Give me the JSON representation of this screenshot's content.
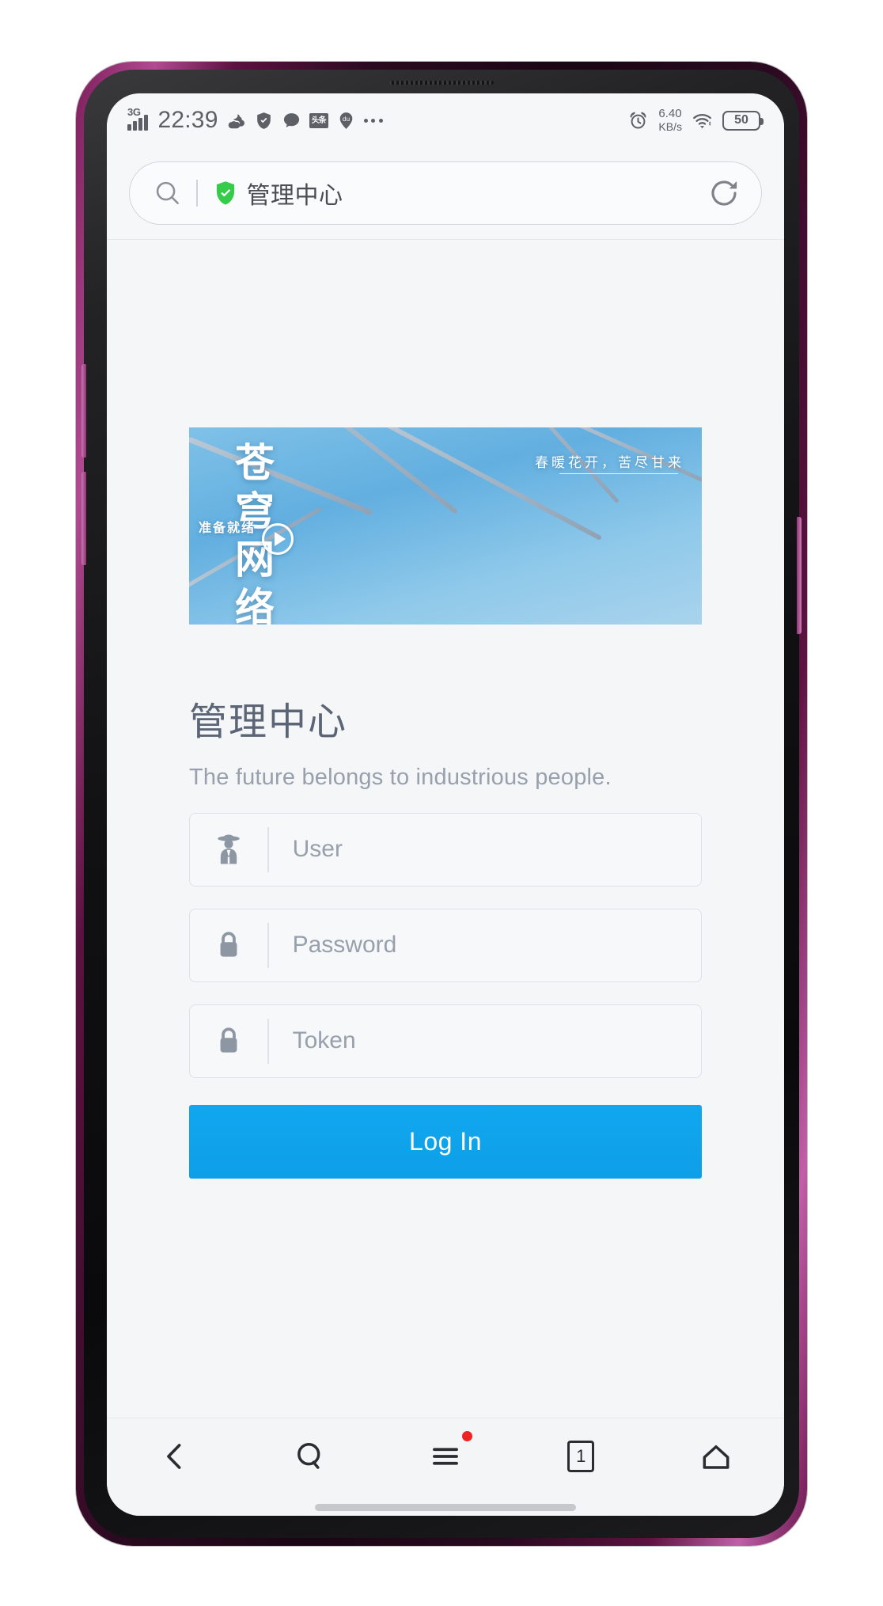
{
  "status_bar": {
    "network_type": "3G",
    "clock": "22:39",
    "icons": [
      "weather-cloud-icon",
      "shield-icon",
      "chat-bubble-icon",
      "toutiao-icon",
      "baidu-map-icon",
      "more-dots-icon"
    ],
    "toutiao_label": "头条",
    "baidu_label": "du",
    "alarm_icon": "alarm-clock-icon",
    "network_speed_value": "6.40",
    "network_speed_unit": "KB/s",
    "wifi_icon": "wifi-icon",
    "battery_level": "50"
  },
  "browser": {
    "search_icon": "search-icon",
    "security_icon": "green-shield-check-icon",
    "page_title": "管理中心",
    "refresh_icon": "refresh-icon"
  },
  "banner": {
    "vertical_title": "苍穹网络",
    "subtitle": "准备就绪",
    "tagline": "春暖花开，苦尽甘来",
    "play_icon": "play-icon"
  },
  "login": {
    "heading": "管理中心",
    "subheading": "The future belongs to industrious people.",
    "fields": [
      {
        "name": "user",
        "icon": "spy-agent-icon",
        "placeholder": "User",
        "value": ""
      },
      {
        "name": "password",
        "icon": "lock-icon",
        "placeholder": "Password",
        "value": ""
      },
      {
        "name": "token",
        "icon": "lock-icon",
        "placeholder": "Token",
        "value": ""
      }
    ],
    "submit_label": "Log In",
    "accent_color": "#11a7ef"
  },
  "bottom_nav": {
    "items": [
      {
        "name": "back",
        "icon": "chevron-left-icon"
      },
      {
        "name": "search",
        "icon": "search-icon"
      },
      {
        "name": "menu",
        "icon": "hamburger-menu-icon",
        "badge": true
      },
      {
        "name": "tabs",
        "icon": "tab-count-icon",
        "count": "1"
      },
      {
        "name": "home",
        "icon": "home-icon"
      }
    ]
  },
  "colors": {
    "frame": "#6d1850",
    "accent": "#11a7ef",
    "shield_green": "#35cc4b",
    "badge_red": "#f02323",
    "text_primary": "#5b6575",
    "text_muted": "#97a0ac"
  }
}
